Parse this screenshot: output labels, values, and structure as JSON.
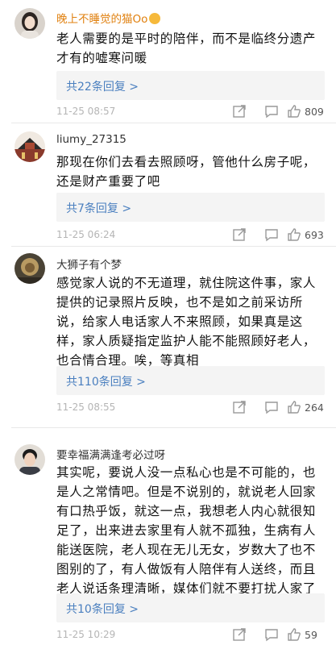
{
  "comments": [
    {
      "username": "晚上不睡觉的猫Oo",
      "text": "老人需要的是平时的陪伴，而不是临终分遗产才有的嘘寒问暖",
      "reply_label": "共22条回复 >",
      "time": "11-25 08:57",
      "likes": "809"
    },
    {
      "username": "liumy_27315",
      "text": "那现在你们去看去照顾呀，管他什么房子呢，还是财产重要了吧",
      "reply_label": "共7条回复 >",
      "time": "11-25 06:24",
      "likes": "693"
    },
    {
      "username": "大狮子有个梦",
      "text": "感觉家人说的不无道理，就住院这件事，家人提供的记录照片反映，也不是如之前采访所说，给家人电话家人不来照顾，如果真是这样，家人质疑指定监护人能不能照顾好老人，也合情合理。唉，等真相",
      "reply_label": "共110条回复 >",
      "time": "11-25 08:55",
      "likes": "264"
    },
    {
      "username": "要幸福满满逢考必过呀",
      "text": "其实呢，要说人没一点私心也是不可能的，也是人之常情吧。但是不说别的，就说老人回家有口热乎饭，就这一点，我想老人内心就很知足了，出来进去家里有人就不孤独，生病有人能送医院，老人现在无儿无女，岁数大了也不图别的了，有人做饭有人陪伴有人送终，而且老人说话条理清晰，媒体们就不要打扰人家了",
      "reply_label": "共10条回复 >",
      "time": "11-25 10:29",
      "likes": "59"
    }
  ],
  "icons": {
    "share": "share-icon",
    "reply": "comment-icon",
    "like": "thumbs-up-icon"
  },
  "colors": {
    "username_highlight": "#e0800f",
    "reply_link": "#4a7fbf",
    "reply_bg": "#f4f4f4"
  }
}
